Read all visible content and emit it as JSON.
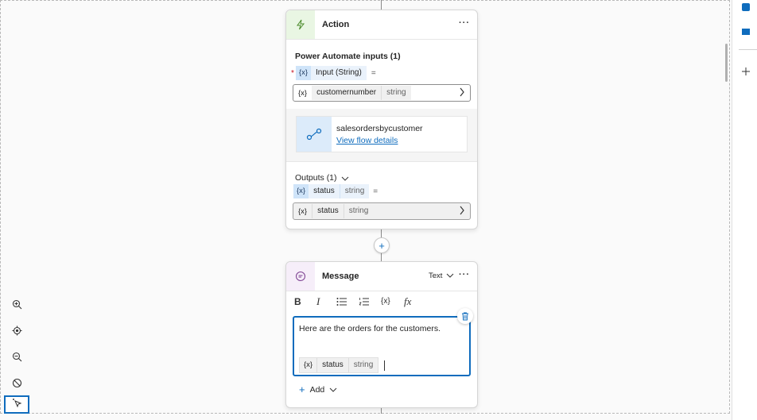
{
  "action_card": {
    "title": "Action",
    "more": "···",
    "inputs_title": "Power Automate inputs (1)",
    "required_mark": "*",
    "input_var_icon": "{x}",
    "input_name": "Input (String)",
    "equals": "=",
    "input_value_icon": "{x}",
    "input_value_name": "customernumber",
    "input_value_type": "string",
    "flow_name": "salesordersbycustomer",
    "flow_link": "View flow details",
    "outputs_title": "Outputs (1)",
    "output_var_icon": "{x}",
    "output_name": "status",
    "output_type": "string",
    "output_equals": "=",
    "output_value_icon": "{x}",
    "output_value_name": "status",
    "output_value_type": "string"
  },
  "add_node": "+",
  "message_card": {
    "title": "Message",
    "more": "···",
    "mode_label": "Text",
    "toolbar": {
      "bold": "B",
      "italic": "I",
      "variable": "{x}",
      "formula": "fx"
    },
    "body_text": "Here are the orders for the customers.",
    "var_icon": "{x}",
    "var_name": "status",
    "var_type": "string",
    "add_label": "Add",
    "add_plus": "+"
  },
  "icons": [
    "lightning-icon",
    "message-icon",
    "flow-icon",
    "delete-icon",
    "zoom-in-icon",
    "center-icon",
    "zoom-out-icon",
    "hide-icon",
    "select-icon"
  ],
  "colors": {
    "action_accent": "#e9f6e3",
    "message_accent": "#f6eef9",
    "var_chip": "#cfe4f9",
    "link": "#0f6cbd",
    "focus_border": "#0f6cbd"
  }
}
